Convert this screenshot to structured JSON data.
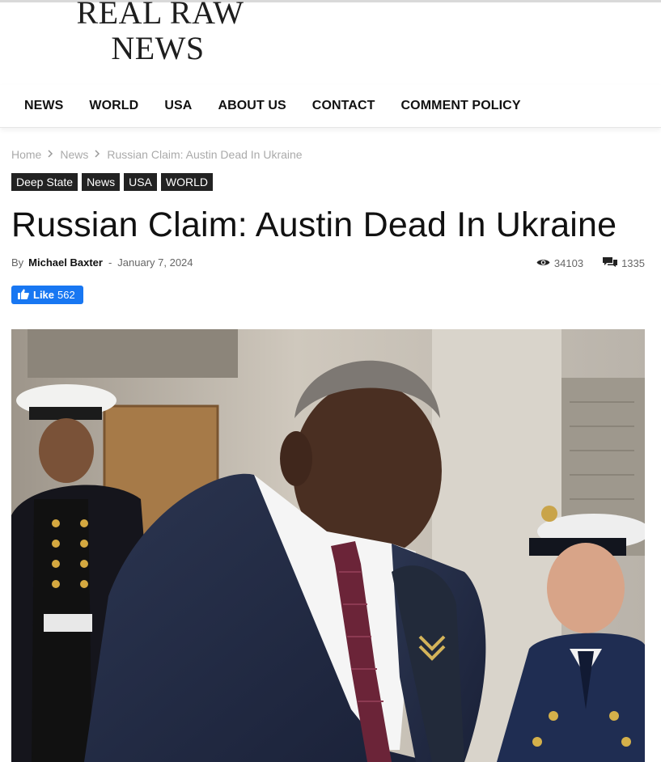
{
  "site": {
    "logo_line1": "REAL RAW",
    "logo_line2": "NEWS"
  },
  "nav": {
    "items": [
      "NEWS",
      "WORLD",
      "USA",
      "ABOUT US",
      "CONTACT",
      "COMMENT POLICY"
    ]
  },
  "breadcrumb": {
    "home": "Home",
    "section": "News",
    "current": "Russian Claim: Austin Dead In Ukraine"
  },
  "categories": [
    "Deep State",
    "News",
    "USA",
    "WORLD"
  ],
  "article": {
    "title": "Russian Claim: Austin Dead In Ukraine",
    "by_label": "By",
    "author": "Michael Baxter",
    "date": "January 7, 2024",
    "views": "34103",
    "comments": "1335"
  },
  "like": {
    "label": "Like",
    "count": "562"
  },
  "icons": {
    "views": "eye-icon",
    "comments": "comments-icon",
    "like": "thumbs-up-icon",
    "breadcrumb_separator": "chevron-right-icon"
  },
  "colors": {
    "facebook_blue": "#1877f2",
    "category_bg": "#222222",
    "breadcrumb_text": "#aaaaaa"
  }
}
